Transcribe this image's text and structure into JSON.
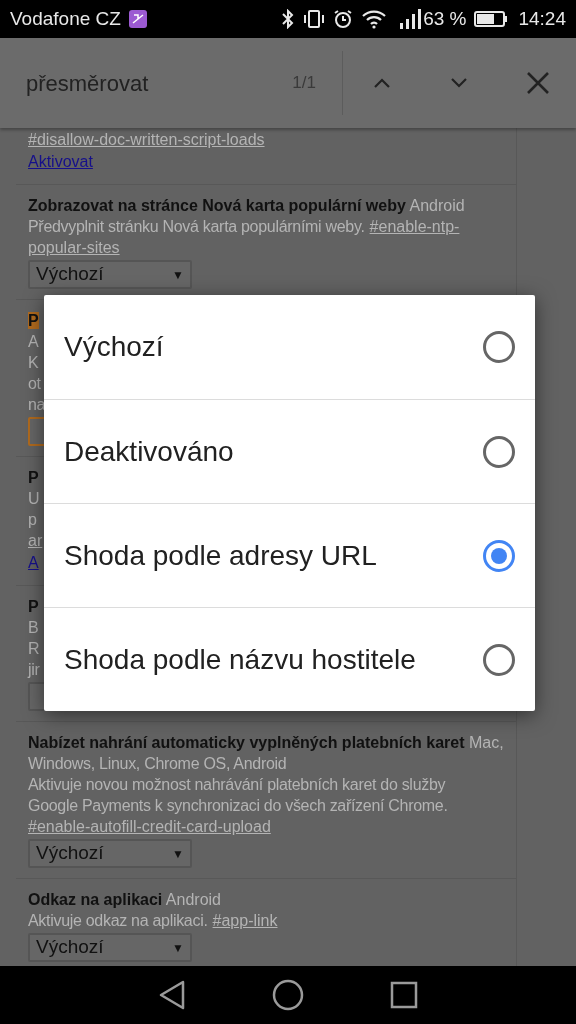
{
  "status_bar": {
    "carrier": "Vodafone CZ",
    "battery": "63 %",
    "time": "14:24"
  },
  "find_bar": {
    "query": "přesměrovat",
    "count": "1/1"
  },
  "sections": [
    {
      "lines": [
        {
          "kind": "hash",
          "text": "#disallow-doc-written-script-loads"
        },
        {
          "kind": "link",
          "text": "Aktivovat"
        }
      ]
    },
    {
      "lines": [
        {
          "kind": "title",
          "text": "Zobrazovat na stránce Nová karta populární weby",
          "platform": "Android"
        },
        {
          "kind": "desc",
          "text": "Předvyplnit stránku Nová karta populárními weby.",
          "hash": "#enable-ntp-"
        },
        {
          "kind": "hash",
          "text": "popular-sites"
        },
        {
          "kind": "select",
          "text": "Výchozí",
          "arrow": "▼"
        }
      ]
    },
    {
      "lines": [
        {
          "kind": "title",
          "text": "P",
          "highlight": true
        },
        {
          "kind": "desc",
          "text": "A"
        },
        {
          "kind": "desc",
          "text": "K"
        },
        {
          "kind": "desc",
          "text": "ot"
        },
        {
          "kind": "desc",
          "text": "na"
        },
        {
          "kind": "select",
          "highlight": true
        }
      ]
    },
    {
      "lines": [
        {
          "kind": "title",
          "text": "P"
        },
        {
          "kind": "desc",
          "text": "U"
        },
        {
          "kind": "desc",
          "text": "p"
        },
        {
          "kind": "hash",
          "text": "ar"
        },
        {
          "kind": "link",
          "text": "A"
        }
      ]
    },
    {
      "lines": [
        {
          "kind": "title",
          "text": "P"
        },
        {
          "kind": "desc",
          "text": "B"
        },
        {
          "kind": "desc",
          "text": "R"
        },
        {
          "kind": "desc",
          "text": "jir"
        },
        {
          "kind": "select",
          "highlight": false
        }
      ]
    },
    {
      "lines": [
        {
          "kind": "title",
          "text": "Nabízet nahrání automaticky vyplněných platebních karet",
          "platform": "Mac,"
        },
        {
          "kind": "desc",
          "text": "Windows, Linux, Chrome OS, Android"
        },
        {
          "kind": "desc",
          "text": "Aktivuje novou možnost nahrávání platebních karet do služby"
        },
        {
          "kind": "desc",
          "text": "Google Payments k synchronizaci do všech zařízení Chrome."
        },
        {
          "kind": "hash",
          "text": "#enable-autofill-credit-card-upload"
        },
        {
          "kind": "select",
          "text": "Výchozí",
          "arrow": "▼"
        }
      ]
    },
    {
      "lines": [
        {
          "kind": "title",
          "text": "Odkaz na aplikaci",
          "platform": "Android"
        },
        {
          "kind": "desc",
          "text": "Aktivuje odkaz na aplikaci.",
          "hash": "#app-link"
        },
        {
          "kind": "select",
          "text": "Výchozí",
          "arrow": "▼"
        }
      ]
    }
  ],
  "dialog": {
    "options": [
      {
        "label": "Výchozí",
        "selected": false
      },
      {
        "label": "Deaktivováno",
        "selected": false
      },
      {
        "label": "Shoda podle adresy URL",
        "selected": true
      },
      {
        "label": "Shoda podle názvu hostitele",
        "selected": false
      }
    ]
  }
}
